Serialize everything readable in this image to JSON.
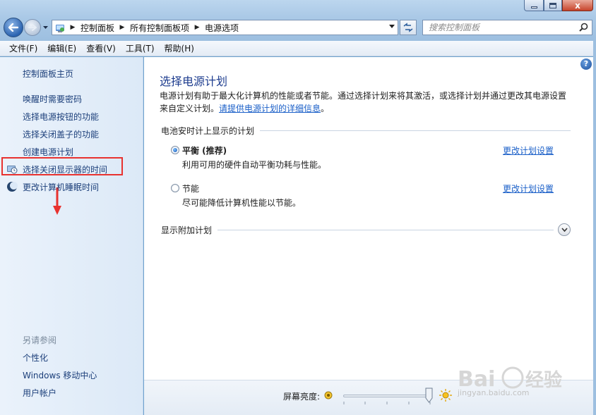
{
  "window": {
    "close_glyph": "x"
  },
  "address_bar": {
    "crumbs": [
      "控制面板",
      "所有控制面板项",
      "电源选项"
    ],
    "separator": "▶"
  },
  "search": {
    "placeholder": "搜索控制面板"
  },
  "menu": [
    "文件(F)",
    "编辑(E)",
    "查看(V)",
    "工具(T)",
    "帮助(H)"
  ],
  "sidebar": {
    "home": "控制面板主页",
    "links": [
      {
        "label": "唤醒时需要密码"
      },
      {
        "label": "选择电源按钮的功能"
      },
      {
        "label": "选择关闭盖子的功能"
      },
      {
        "label": "创建电源计划"
      },
      {
        "label": "选择关闭显示器的时间",
        "icon": "monitor-clock-icon",
        "highlighted": true
      },
      {
        "label": "更改计算机睡眠时间",
        "icon": "moon-icon"
      }
    ],
    "see_also_heading": "另请参阅",
    "see_also": [
      "个性化",
      "Windows 移动中心",
      "用户帐户"
    ]
  },
  "main": {
    "help_glyph": "?",
    "title": "选择电源计划",
    "description_line1": "电源计划有助于最大化计算机的性能或者节能。通过选择计划来将其激活，或选择计划并通过更改其电源设置",
    "description_line2_prefix": "来自定义计划。",
    "description_link": "请提供电源计划的详细信息",
    "description_line2_suffix": "。",
    "group_label": "电池安时计上显示的计划",
    "plans": [
      {
        "name": "平衡 (推荐)",
        "desc": "利用可用的硬件自动平衡功耗与性能。",
        "link": "更改计划设置",
        "selected": true
      },
      {
        "name": "节能",
        "desc": "尽可能降低计算机性能以节能。",
        "link": "更改计划设置",
        "selected": false
      }
    ],
    "additional_label": "显示附加计划"
  },
  "brightness": {
    "label": "屏幕亮度:",
    "level_fraction": 1.0
  },
  "watermark": {
    "text": "jingyan.baidu.com"
  },
  "colors": {
    "link": "#1c3f7a",
    "title": "#1e3d8f",
    "highlight_box": "#e8322f",
    "arrow": "#e8322f"
  }
}
